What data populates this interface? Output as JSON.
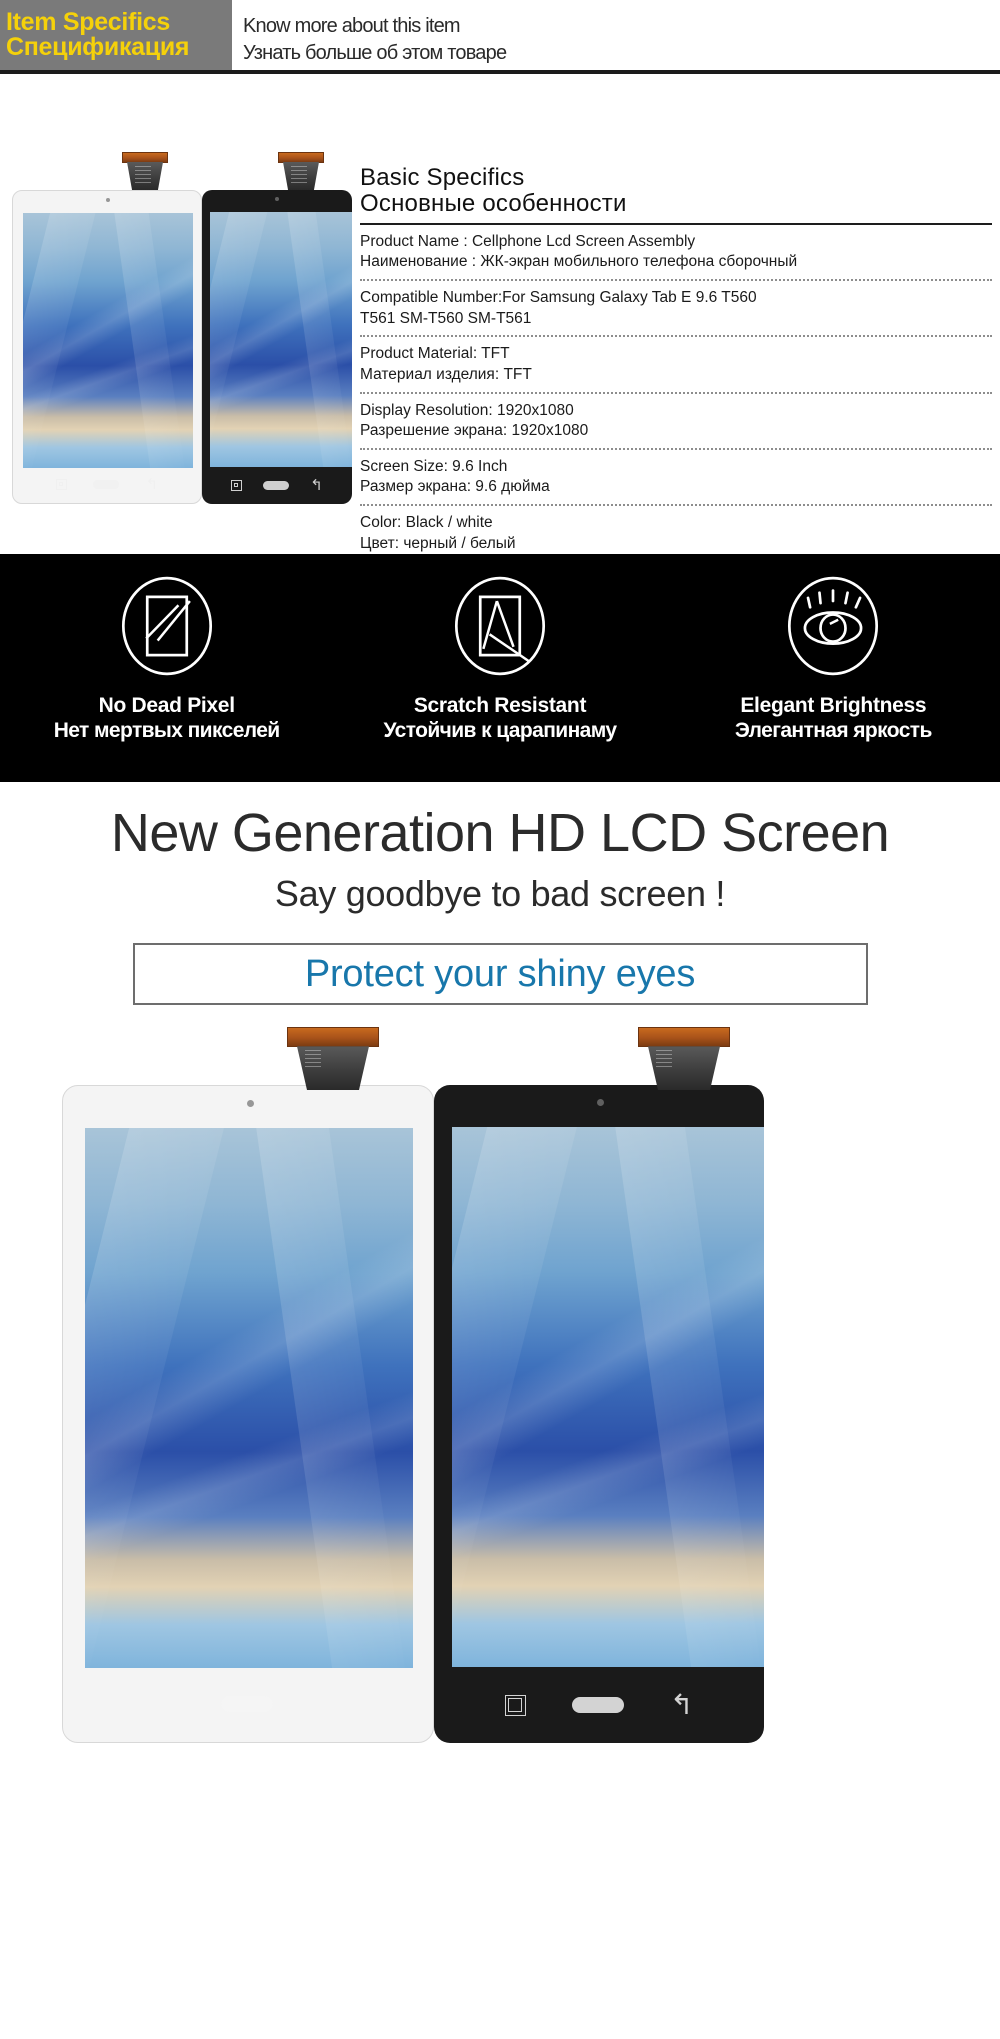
{
  "header": {
    "badge_en": "Item Specifics",
    "badge_ru": "Спецификация",
    "sub_en": "Know more about this item",
    "sub_ru": "Узнать больше об этом товаре",
    "badge_bg": "#7a7a7a",
    "badge_color": "#f5d10a"
  },
  "specs": {
    "title_en": "Basic  Specifics",
    "title_ru": "Основные особенности",
    "rows": [
      {
        "en": "Product Name :  Cellphone Lcd Screen Assembly",
        "ru": "Наименование :  ЖК-экран мобильного телефона сборочный"
      },
      {
        "en": "Compatible Number:For Samsung Galaxy Tab E 9.6 T560",
        "ru": " T561 SM-T560 SM-T561"
      },
      {
        "en": "Product  Material: TFT",
        "ru": "Материал изделия: TFT"
      },
      {
        "en": "Display Resolution: 1920x1080",
        "ru": "Разрешение экрана: 1920x1080"
      },
      {
        "en": "Screen Size:  9.6 Inch",
        "ru": "Размер экрана: 9.6 дюйма"
      },
      {
        "en": "Color: Black / white",
        "ru": "Цвет: черный / белый"
      }
    ]
  },
  "features": {
    "background": "#000000",
    "items": [
      {
        "icon": "no-dead-pixel-icon",
        "en": "No Dead Pixel",
        "ru": "Нет мертвых пикселей"
      },
      {
        "icon": "scratch-resistant-icon",
        "en": "Scratch Resistant",
        "ru": "Устойчив к царапинаму"
      },
      {
        "icon": "elegant-brightness-icon",
        "en": "Elegant Brightness",
        "ru": "Элегантная яркость"
      }
    ]
  },
  "headline": {
    "title": "New Generation HD LCD Screen",
    "subtitle": "Say goodbye to bad screen !",
    "cta": "Protect your shiny eyes",
    "cta_color": "#1877ab"
  },
  "product_images": {
    "top": [
      {
        "variant": "white",
        "nav": {
          "recents": "recents-icon",
          "home": "home-icon",
          "back": "back-icon"
        }
      },
      {
        "variant": "black",
        "nav": {
          "recents": "recents-icon",
          "home": "home-icon",
          "back": "back-icon"
        }
      }
    ],
    "bottom": [
      {
        "variant": "white",
        "nav": {
          "recents": "recents-icon",
          "home": "home-icon",
          "back": "back-icon"
        }
      },
      {
        "variant": "black",
        "nav": {
          "recents": "recents-icon",
          "home": "home-icon",
          "back": "back-icon"
        }
      }
    ]
  }
}
